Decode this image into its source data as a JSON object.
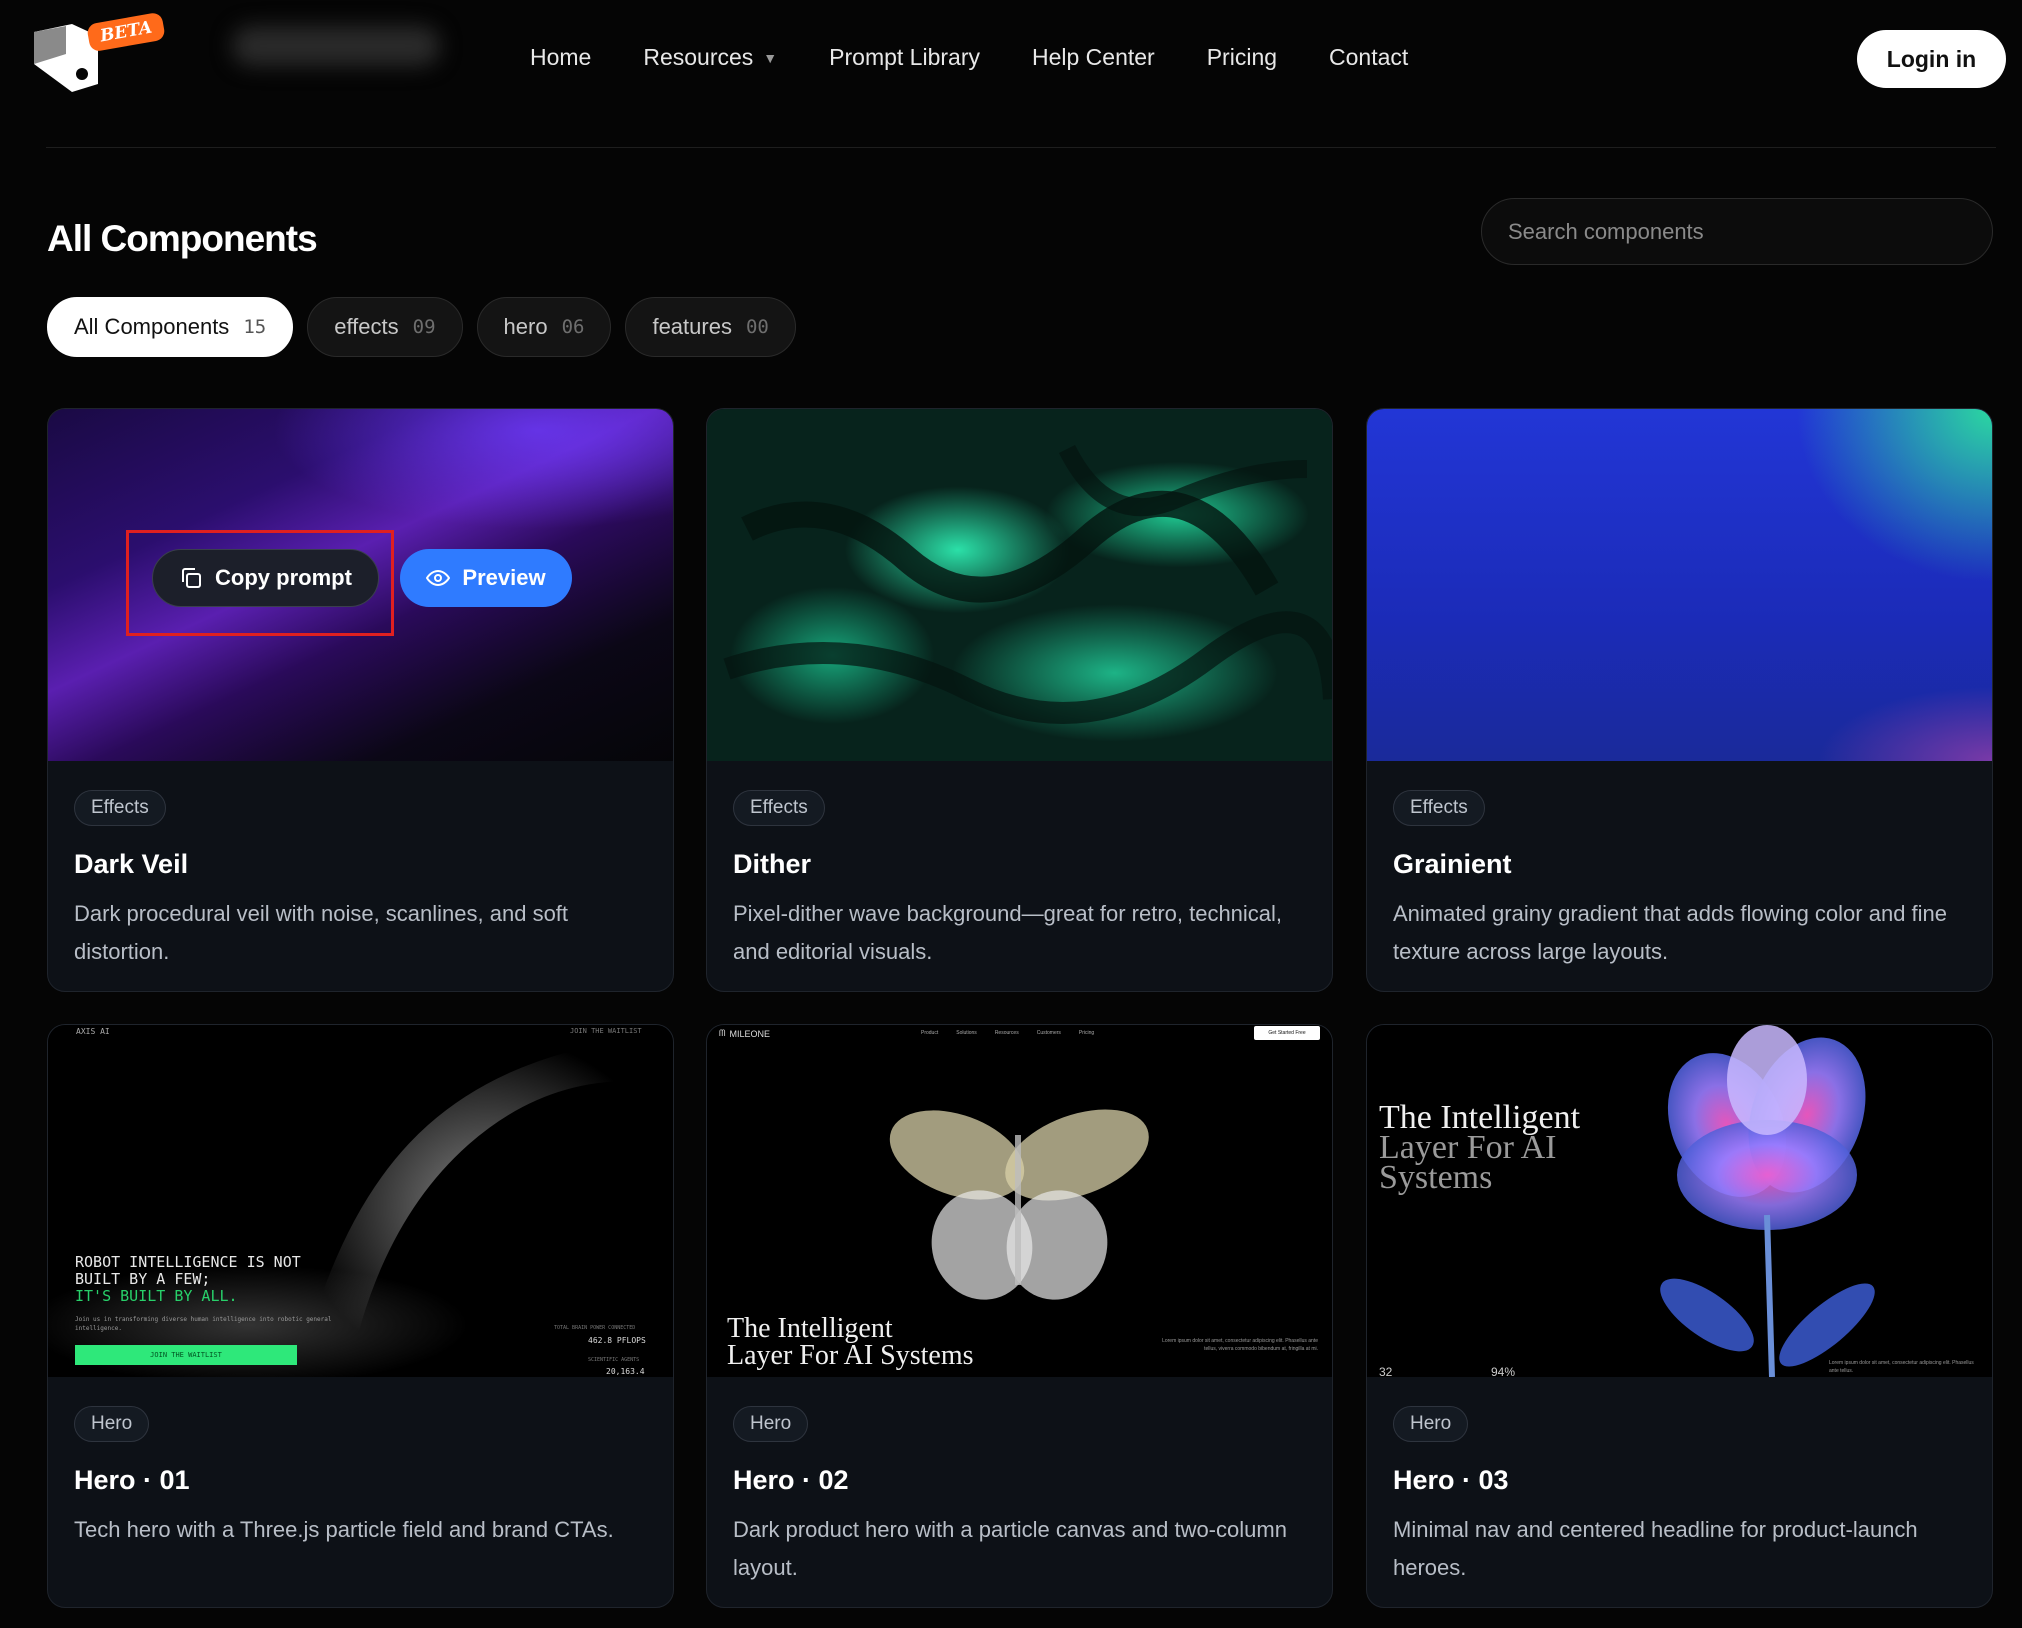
{
  "nav": {
    "beta": "BETA",
    "links": [
      "Home",
      "Resources",
      "Prompt Library",
      "Help Center",
      "Pricing",
      "Contact"
    ],
    "login": "Login in"
  },
  "header": {
    "title": "All Components",
    "search_placeholder": "Search components"
  },
  "filters": [
    {
      "label": "All Components",
      "count": "15"
    },
    {
      "label": "effects",
      "count": "09"
    },
    {
      "label": "hero",
      "count": "06"
    },
    {
      "label": "features",
      "count": "00"
    }
  ],
  "actions": {
    "copy": "Copy prompt",
    "preview": "Preview"
  },
  "cards": [
    {
      "tag": "Effects",
      "title": "Dark Veil",
      "desc": "Dark procedural veil with noise, scanlines, and soft distortion."
    },
    {
      "tag": "Effects",
      "title": "Dither",
      "desc": "Pixel-dither wave background—great for retro, technical, and editorial visuals."
    },
    {
      "tag": "Effects",
      "title": "Grainient",
      "desc": "Animated grainy gradient that adds flowing color and fine texture across large layouts."
    },
    {
      "tag": "Hero",
      "title": "Hero · 01",
      "desc": "Tech hero with a Three.js particle field and brand CTAs."
    },
    {
      "tag": "Hero",
      "title": "Hero · 02",
      "desc": "Dark product hero with a particle canvas and two-column layout."
    },
    {
      "tag": "Hero",
      "title": "Hero · 03",
      "desc": "Minimal nav and centered headline for product-launch heroes."
    }
  ],
  "thumbs": {
    "hero1": {
      "brand": "AXIS AI",
      "waitlist_top": "JOIN THE WAITLIST",
      "line1": "ROBOT INTELLIGENCE IS NOT",
      "line2": "BUILT BY A FEW;",
      "line3": "IT'S BUILT BY ALL.",
      "sub": "Join us in transforming diverse human intelligence into robotic general intelligence.",
      "cta": "JOIN THE WAITLIST",
      "stat1_label": "TOTAL BRAIN POWER CONNECTED",
      "stat1": "462.8 PFLOPS",
      "stat2_label": "SCIENTIFIC AGENTS",
      "stat2": "20,163.4"
    },
    "hero2": {
      "brand": "MILEONE",
      "links": [
        "Product",
        "Solutions",
        "Resources",
        "Customers",
        "Pricing"
      ],
      "cta": "Get Started Free",
      "headline1": "The Intelligent",
      "headline2": "Layer For AI Systems",
      "body": "Lorem ipsum dolor sit amet, consectetur adipiscing elit. Phasellus ante tellus, viverra commodo bibendum at, fringilla at mi."
    },
    "hero3": {
      "headline1": "The Intelligent",
      "headline2": "Layer For AI",
      "headline3": "Systems",
      "stat1": "32",
      "stat2": "94%",
      "body": "Lorem ipsum dolor sit amet, consectetur adipiscing elit. Phasellus ante tellus."
    }
  },
  "colors": {
    "accent": "#2f7bff",
    "highlight": "#e02020",
    "beta": "#ff6a1a"
  }
}
